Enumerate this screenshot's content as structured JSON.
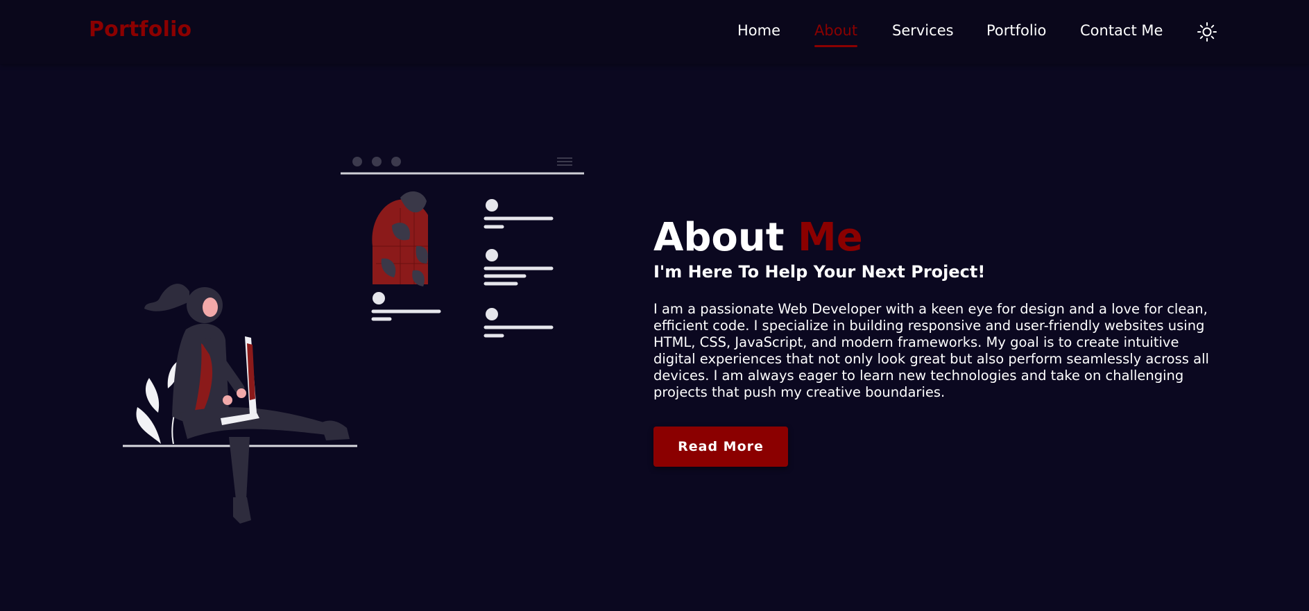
{
  "header": {
    "logo": "Portfolio",
    "nav": {
      "home": "Home",
      "about": "About",
      "services": "Services",
      "portfolio": "Portfolio",
      "contact": "Contact Me"
    },
    "active_item": "About",
    "theme_icon": "sun-icon"
  },
  "about": {
    "title_main": "About",
    "title_accent": "Me",
    "subtitle": "I'm Here To Help Your Next Project!",
    "paragraph": "I am a passionate Web Developer with a keen eye for design and a love for clean, efficient code. I specialize in building responsive and user-friendly websites using HTML, CSS, JavaScript, and modern frameworks. My goal is to create intuitive digital experiences that not only look great but also perform seamlessly across all devices. I am always eager to learn new technologies and take on challenging projects that push my creative boundaries.",
    "button_label": "Read More"
  },
  "colors": {
    "background": "#0b0820",
    "header_background": "#0a071b",
    "accent": "#8b0000",
    "text": "#ffffff"
  }
}
